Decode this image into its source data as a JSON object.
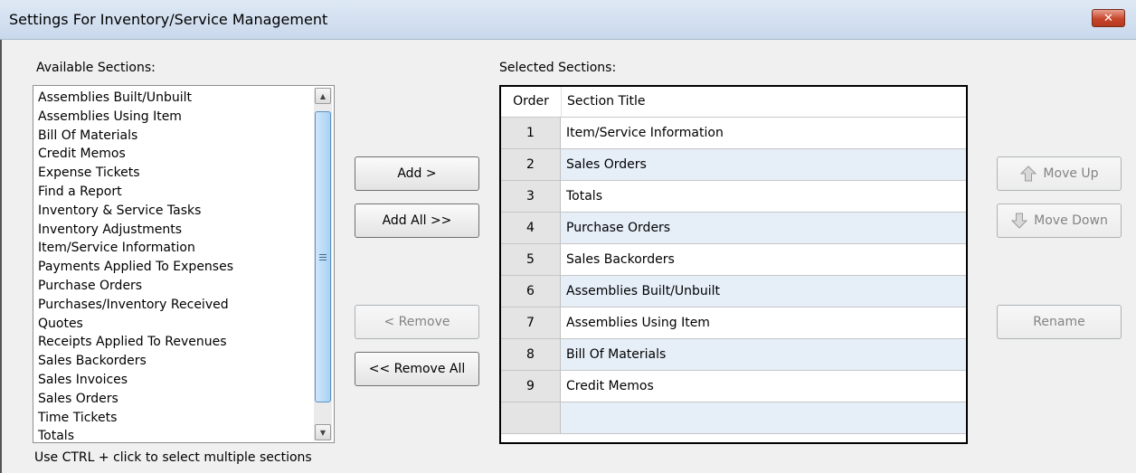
{
  "window": {
    "title": "Settings For Inventory/Service Management",
    "close_label": "✕"
  },
  "available": {
    "label": "Available Sections:",
    "items": [
      "Assemblies Built/Unbuilt",
      "Assemblies Using Item",
      "Bill Of Materials",
      "Credit Memos",
      "Expense Tickets",
      "Find a Report",
      "Inventory & Service Tasks",
      "Inventory Adjustments",
      "Item/Service Information",
      "Payments Applied To Expenses",
      "Purchase Orders",
      "Purchases/Inventory Received",
      "Quotes",
      "Receipts Applied To Revenues",
      "Sales Backorders",
      "Sales Invoices",
      "Sales Orders",
      "Time Tickets",
      "Totals"
    ]
  },
  "buttons": {
    "add": "Add >",
    "add_all": "Add All >>",
    "remove": "< Remove",
    "remove_all": "<< Remove All",
    "move_up": "Move Up",
    "move_down": "Move Down",
    "rename": "Rename"
  },
  "selected": {
    "label": "Selected Sections:",
    "columns": [
      "Order",
      "Section Title"
    ],
    "rows": [
      {
        "order": "1",
        "title": "Item/Service Information"
      },
      {
        "order": "2",
        "title": "Sales Orders"
      },
      {
        "order": "3",
        "title": "Totals"
      },
      {
        "order": "4",
        "title": "Purchase Orders"
      },
      {
        "order": "5",
        "title": "Sales Backorders"
      },
      {
        "order": "6",
        "title": "Assemblies Built/Unbuilt"
      },
      {
        "order": "7",
        "title": "Assemblies Using Item"
      },
      {
        "order": "8",
        "title": "Bill Of Materials"
      },
      {
        "order": "9",
        "title": "Credit Memos"
      }
    ]
  },
  "hint": "Use CTRL + click to select multiple sections"
}
